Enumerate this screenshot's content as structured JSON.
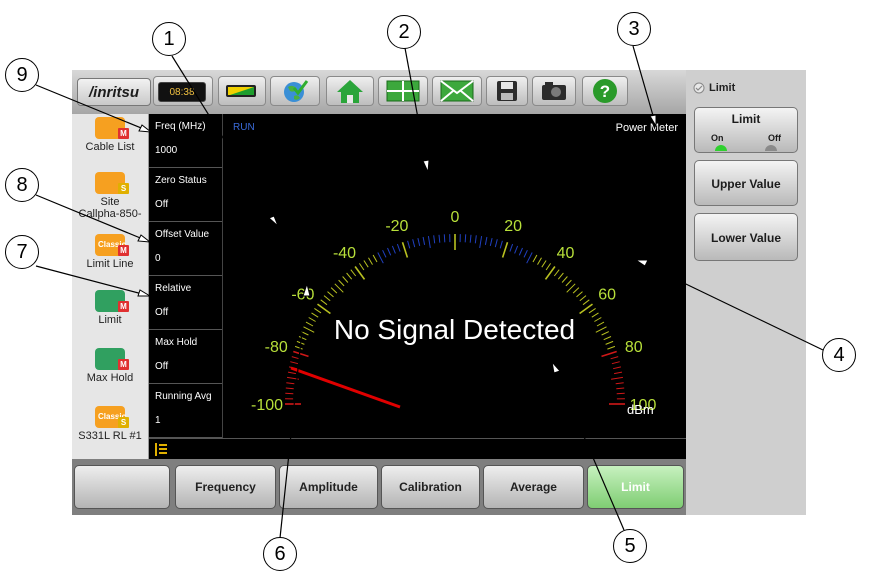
{
  "header": {
    "logo": "/inritsu",
    "clock": "08:38",
    "icons": [
      "battery-icon",
      "globe-check-icon",
      "home-icon",
      "grid-view-icon",
      "envelope-icon",
      "save-icon",
      "camera-icon",
      "help-icon"
    ]
  },
  "left_icons": [
    {
      "label": "Cable List",
      "badge": "M",
      "badge_color": "#e03030"
    },
    {
      "label": "Site\nCallpha-850-",
      "badge": "S",
      "badge_color": "#e0b000"
    },
    {
      "label": "Limit Line",
      "badge": "M",
      "badge_color": "#e03030",
      "tag": "Classic"
    },
    {
      "label": "Limit",
      "badge": "M",
      "badge_color": "#e03030"
    },
    {
      "label": "Max Hold",
      "badge": "M",
      "badge_color": "#e03030"
    },
    {
      "label": "S331L RL #1",
      "badge": "S",
      "badge_color": "#e0b000",
      "tag": "Classic"
    }
  ],
  "params": [
    {
      "label": "Freq (MHz)",
      "value": "1000"
    },
    {
      "label": "Zero Status",
      "value": "Off"
    },
    {
      "label": "Offset Value",
      "value": "0"
    },
    {
      "label": "Relative",
      "value": "Off"
    },
    {
      "label": "Max Hold",
      "value": "Off"
    },
    {
      "label": "Running Avg",
      "value": "1"
    }
  ],
  "display": {
    "run_status": "RUN",
    "mode_title": "Power Meter",
    "message": "No Signal Detected",
    "unit": "dBm",
    "scale_labels": [
      "-100",
      "-80",
      "-60",
      "-40",
      "-20",
      "0",
      "20",
      "40",
      "60",
      "80",
      "100"
    ],
    "scale_min": -100,
    "scale_max": 100,
    "needle_value": -100,
    "lower_limit": -80,
    "upper_limit": 80,
    "colors": {
      "label": "#b8e03a",
      "tick": "#b8c020",
      "limit": "#d01818",
      "band": "#2040c0",
      "needle": "#e00000"
    }
  },
  "bottom_menu": {
    "buttons": [
      "",
      "Frequency",
      "Amplitude",
      "Calibration",
      "Average",
      "Limit"
    ],
    "active": "Limit"
  },
  "right_menu": {
    "title": "Limit",
    "limit_button": {
      "label": "Limit",
      "on": "On",
      "off": "Off"
    },
    "upper_value": "Upper Value",
    "lower_value": "Lower Value"
  },
  "callouts": [
    "1",
    "2",
    "3",
    "4",
    "5",
    "6",
    "7",
    "8",
    "9"
  ]
}
